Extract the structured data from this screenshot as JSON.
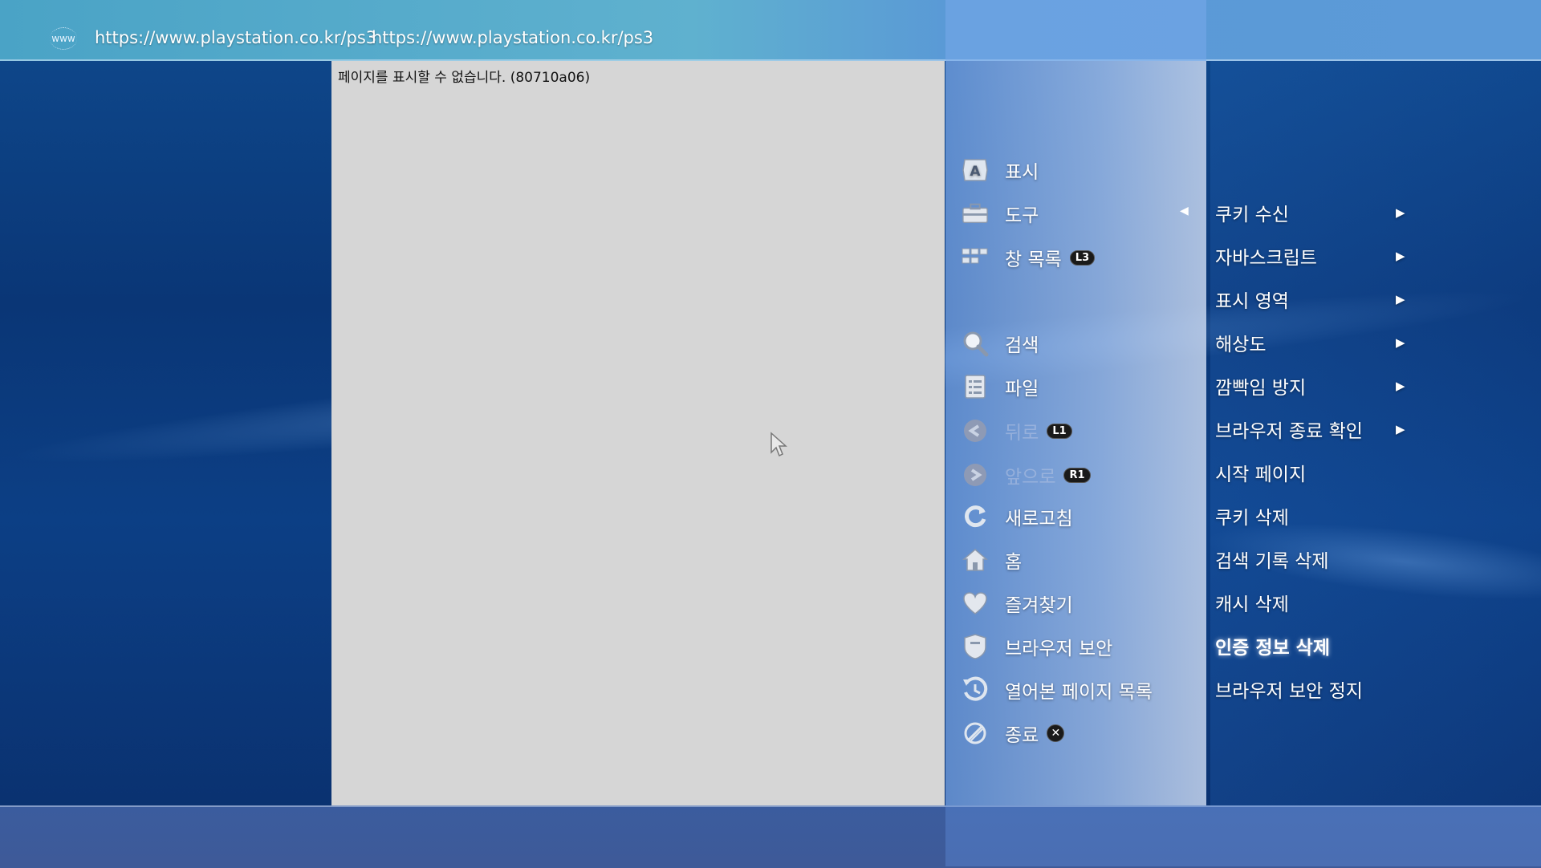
{
  "header": {
    "www_label": "www",
    "url_primary": "https://www.playstation.co.kr/ps3",
    "url_secondary": "https://www.playstation.co.kr/ps3"
  },
  "page": {
    "error_message": "페이지를 표시할 수 없습니다. (80710a06)"
  },
  "menu": {
    "items": [
      {
        "label": "표시",
        "icon": "display-a-icon",
        "enabled": true
      },
      {
        "label": "도구",
        "icon": "toolbox-icon",
        "enabled": true,
        "expanded": true
      },
      {
        "label": "창 목록",
        "icon": "window-list-icon",
        "badge": "L3",
        "enabled": true
      },
      {
        "label": "검색",
        "icon": "search-icon",
        "enabled": true
      },
      {
        "label": "파일",
        "icon": "file-icon",
        "enabled": true
      },
      {
        "label": "뒤로",
        "icon": "back-icon",
        "badge": "L1",
        "enabled": false
      },
      {
        "label": "앞으로",
        "icon": "forward-icon",
        "badge": "R1",
        "enabled": false
      },
      {
        "label": "새로고침",
        "icon": "refresh-icon",
        "enabled": true
      },
      {
        "label": "홈",
        "icon": "home-icon",
        "enabled": true
      },
      {
        "label": "즐겨찾기",
        "icon": "heart-icon",
        "enabled": true
      },
      {
        "label": "브라우저 보안",
        "icon": "shield-icon",
        "enabled": true
      },
      {
        "label": "열어본 페이지 목록",
        "icon": "history-icon",
        "enabled": true
      },
      {
        "label": "종료",
        "icon": "exit-icon",
        "badge": "✕",
        "enabled": true
      }
    ]
  },
  "submenu": {
    "items": [
      {
        "label": "쿠키 수신",
        "has_arrow": true
      },
      {
        "label": "자바스크립트",
        "has_arrow": true
      },
      {
        "label": "표시 영역",
        "has_arrow": true
      },
      {
        "label": "해상도",
        "has_arrow": true
      },
      {
        "label": "깜빡임 방지",
        "has_arrow": true
      },
      {
        "label": "브라우저 종료 확인",
        "has_arrow": true
      },
      {
        "label": "시작 페이지",
        "has_arrow": false
      },
      {
        "label": "쿠키 삭제",
        "has_arrow": false
      },
      {
        "label": "검색 기록 삭제",
        "has_arrow": false
      },
      {
        "label": "캐시 삭제",
        "has_arrow": false
      },
      {
        "label": "인증 정보 삭제",
        "has_arrow": false,
        "selected": true
      },
      {
        "label": "브라우저 보안 정지",
        "has_arrow": false
      }
    ]
  },
  "colors": {
    "page_background": "#d6d6d6",
    "menu_accent": "#7aa5e6"
  }
}
